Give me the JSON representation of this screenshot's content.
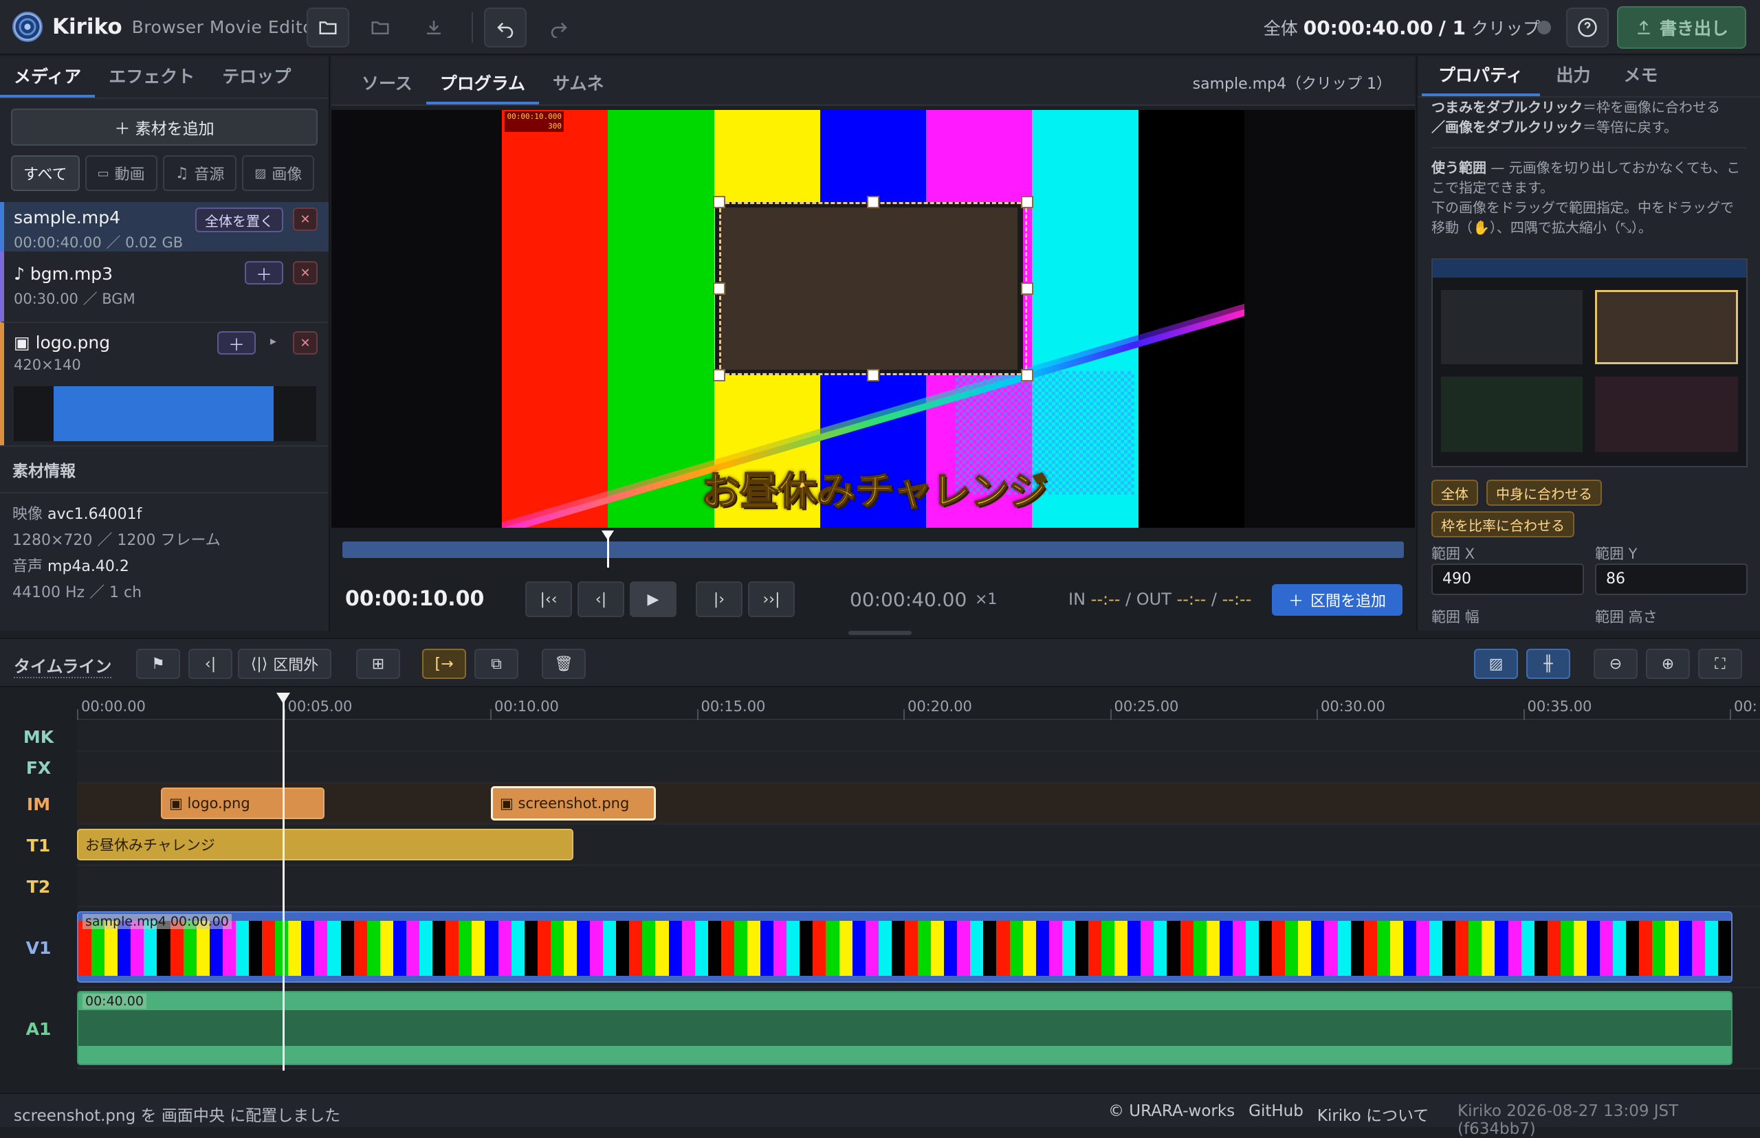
{
  "app": {
    "name": "Kiriko",
    "subtitle": "Browser Movie Editor"
  },
  "header": {
    "total_label": "全体",
    "total_duration": "00:00:40.00",
    "clip_count": "/ 1",
    "clip_unit": "クリップ",
    "export_label": "書き出し"
  },
  "left": {
    "tabs": [
      "メディア",
      "エフェクト",
      "テロップ"
    ],
    "add_media": "＋ 素材を追加",
    "filters": [
      "すべて",
      "動画",
      "音源",
      "画像"
    ],
    "items": [
      {
        "name": "sample.mp4",
        "meta": "00:00:40.00 ／ 0.02 GB",
        "action": "全体を置く",
        "color": "#3f7bd9"
      },
      {
        "name": "♪ bgm.mp3",
        "meta": "00:30.00 ／ BGM",
        "color": "#7b6bd9"
      },
      {
        "name": "▣ logo.png",
        "meta": "420×140",
        "color": "#d9903f"
      }
    ],
    "info_title": "素材情報",
    "info": {
      "video_label": "映像",
      "video_codec": "avc1.64001f",
      "video_detail": "1280×720 ／ 1200 フレーム",
      "audio_label": "音声",
      "audio_codec": "mp4a.40.2",
      "audio_detail": "44100 Hz ／ 1 ch"
    }
  },
  "center": {
    "tabs": [
      "ソース",
      "プログラム",
      "サムネ"
    ],
    "active_tab": "プログラム",
    "source_info": "sample.mp4（クリップ 1）",
    "telop": "お昼休みチャレンジ",
    "burned_tc": "00:00:10.000",
    "burned_frame": "300",
    "current_time": "00:00:10.00",
    "total_time": "00:00:40.00",
    "speed": "×1",
    "in_label": "IN",
    "in_value": "--:--",
    "out_label": "/ OUT",
    "out_value": "--:--",
    "out_sep": "/",
    "out_value2": "--:--",
    "add_range": "区間を追加",
    "playhead_fraction": 0.25
  },
  "right": {
    "tabs": [
      "プロパティ",
      "出力",
      "メモ"
    ],
    "note1_bold1": "つまみをダブルクリック",
    "note1_rest1": "＝枠を画像に合わせる",
    "note1_bold2": "／画像をダブルクリック",
    "note1_rest2": "＝等倍に戻す。",
    "range_title": "使う範囲",
    "range_desc": " — 元画像を切り出しておかなくても、ここで指定できます。",
    "range_desc2": "下の画像をドラッグで範囲指定。中をドラッグで移動（✋）、四隅で拡大縮小（⤡）。",
    "buttons": [
      "全体",
      "中身に合わせる",
      "枠を比率に合わせる"
    ],
    "x_label": "範囲 X",
    "x_value": "490",
    "y_label": "範囲 Y",
    "y_value": "86",
    "w_label": "範囲 幅",
    "h_label": "範囲 高さ"
  },
  "timeline": {
    "title": "タイムライン",
    "out_of_range": "区間外",
    "ticks": [
      "00:00.00",
      "00:05.00",
      "00:10.00",
      "00:15.00",
      "00:20.00",
      "00:25.00",
      "00:30.00",
      "00:35.00",
      "00:"
    ],
    "tracks": [
      {
        "label": "MK",
        "color": "#8fd1c2"
      },
      {
        "label": "FX",
        "color": "#8fd1c2"
      },
      {
        "label": "IM",
        "color": "#f2a65a"
      },
      {
        "label": "T1",
        "color": "#f2c95a"
      },
      {
        "label": "T2",
        "color": "#f2c95a"
      },
      {
        "label": "V1",
        "color": "#8fb0e6"
      },
      {
        "label": "A1",
        "color": "#6fd19a"
      }
    ],
    "clips": {
      "logo": "▣ logo.png",
      "screenshot": "▣ screenshot.png",
      "telop": "お昼休みチャレンジ",
      "video": "sample.mp4  00:00.00",
      "audio": "00:40.00"
    }
  },
  "status": {
    "message": "screenshot.png を 画面中央 に配置しました",
    "copyright": "© URARA-works",
    "github": "GitHub",
    "about": "Kiriko について",
    "version": "Kiriko 2026-08-27 13:09 JST (f634bb7)"
  }
}
